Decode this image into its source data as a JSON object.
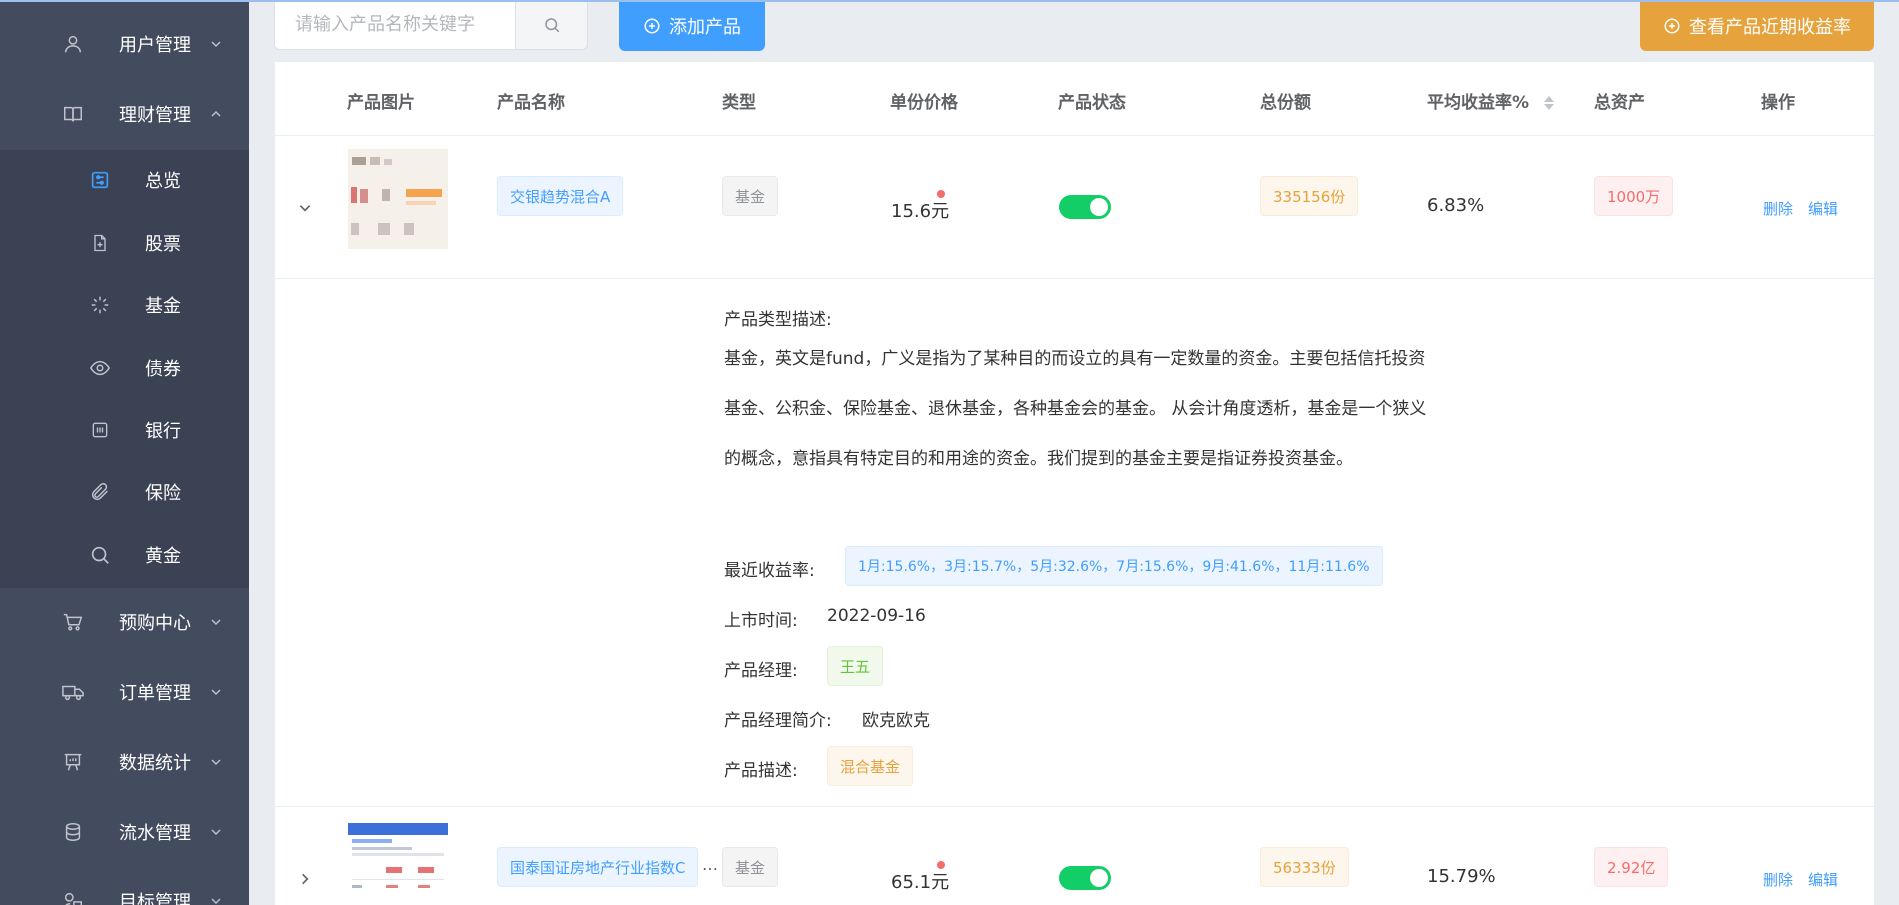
{
  "sidebar": {
    "menus": [
      {
        "label": "用户管理",
        "icon": "user-icon"
      },
      {
        "label": "理财管理",
        "icon": "book-icon",
        "expanded": true
      },
      {
        "label": "预购中心",
        "icon": "cart-icon"
      },
      {
        "label": "订单管理",
        "icon": "truck-icon"
      },
      {
        "label": "数据统计",
        "icon": "presentation-icon"
      },
      {
        "label": "流水管理",
        "icon": "coins-icon"
      },
      {
        "label": "目标管理",
        "icon": "target-icon"
      }
    ],
    "submenu": [
      {
        "label": "总览",
        "icon": "overview-icon",
        "active": true
      },
      {
        "label": "股票",
        "icon": "document-add-icon"
      },
      {
        "label": "基金",
        "icon": "loading-icon"
      },
      {
        "label": "债券",
        "icon": "eye-icon"
      },
      {
        "label": "银行",
        "icon": "bank-icon"
      },
      {
        "label": "保险",
        "icon": "paperclip-icon"
      },
      {
        "label": "黄金",
        "icon": "search-icon"
      }
    ]
  },
  "toolbar": {
    "search_placeholder": "请输入产品名称关键字",
    "add_label": "添加产品",
    "rate_label": "查看产品近期收益率"
  },
  "table": {
    "headers": {
      "image": "产品图片",
      "name": "产品名称",
      "type": "类型",
      "price": "单份价格",
      "status": "产品状态",
      "shares": "总份额",
      "avg_rate": "平均收益率%",
      "assets": "总资产",
      "actions": "操作"
    },
    "delete_label": "删除",
    "edit_label": "编辑",
    "rows": [
      {
        "name": "交银趋势混合A",
        "type": "基金",
        "price": "15.6元",
        "status_on": true,
        "shares": "335156份",
        "avg_rate": "6.83%",
        "assets": "1000万",
        "expanded": true
      },
      {
        "name": "国泰国证房地产行业指数C",
        "type": "基金",
        "price": "65.1元",
        "status_on": true,
        "shares": "56333份",
        "avg_rate": "15.79%",
        "assets": "2.92亿",
        "expanded": false
      }
    ]
  },
  "detail": {
    "type_desc_label": "产品类型描述:",
    "type_desc": "基金，英文是fund，广义是指为了某种目的而设立的具有一定数量的资金。主要包括信托投资基金、公积金、保险基金、退休基金，各种基金会的基金。 从会计角度透析，基金是一个狭义的概念，意指具有特定目的和用途的资金。我们提到的基金主要是指证券投资基金。",
    "recent_rate_label": "最近收益率:",
    "recent_rate": "1月:15.6%，3月:15.7%，5月:32.6%，7月:15.6%，9月:41.6%，11月:11.6%",
    "listing_label": "上市时间:",
    "listing": "2022-09-16",
    "manager_label": "产品经理:",
    "manager": "王五",
    "manager_intro_label": "产品经理简介:",
    "manager_intro": "欧克欧克",
    "product_desc_label": "产品描述:",
    "product_desc": "混合基金"
  },
  "colors": {
    "sidebar_bg": "#434b5e",
    "primary": "#409eff",
    "warning": "#e6a23c",
    "success": "#13ce66",
    "danger": "#f56c6c"
  }
}
